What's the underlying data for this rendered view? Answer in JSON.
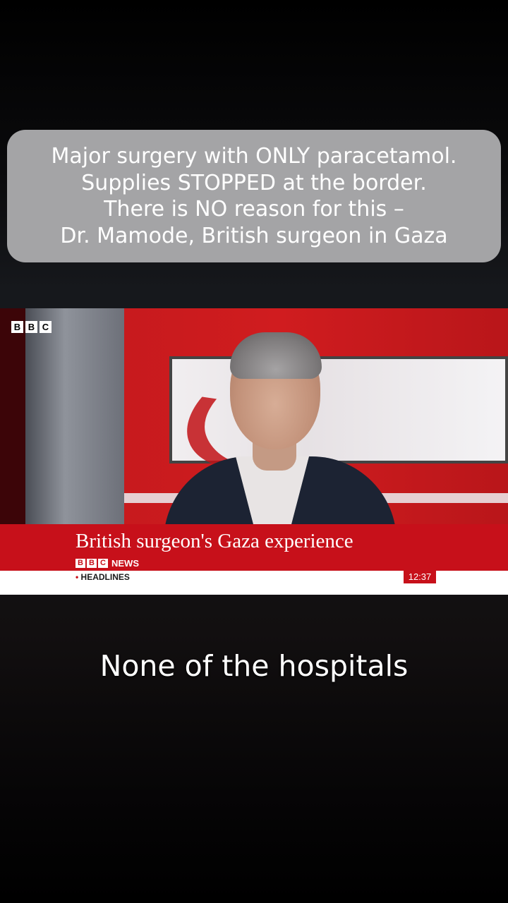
{
  "caption": {
    "lines": [
      "Major surgery with ONLY paracetamol.",
      "Supplies STOPPED at the border.",
      "There is NO reason for this –",
      "Dr. Mamode, British surgeon in Gaza"
    ]
  },
  "video": {
    "corner_logo": [
      "B",
      "B",
      "C"
    ],
    "lower_third": {
      "headline": "British surgeon's Gaza experience",
      "brand_letters": [
        "B",
        "B",
        "C"
      ],
      "brand_text": "NEWS",
      "ticker_bullet": "•",
      "ticker_label": "HEADLINES",
      "clock": "12:37"
    }
  },
  "subtitle": "None of the hospitals",
  "colors": {
    "bbc_red": "#c7101a",
    "caption_bg": "#a4a4a6"
  }
}
